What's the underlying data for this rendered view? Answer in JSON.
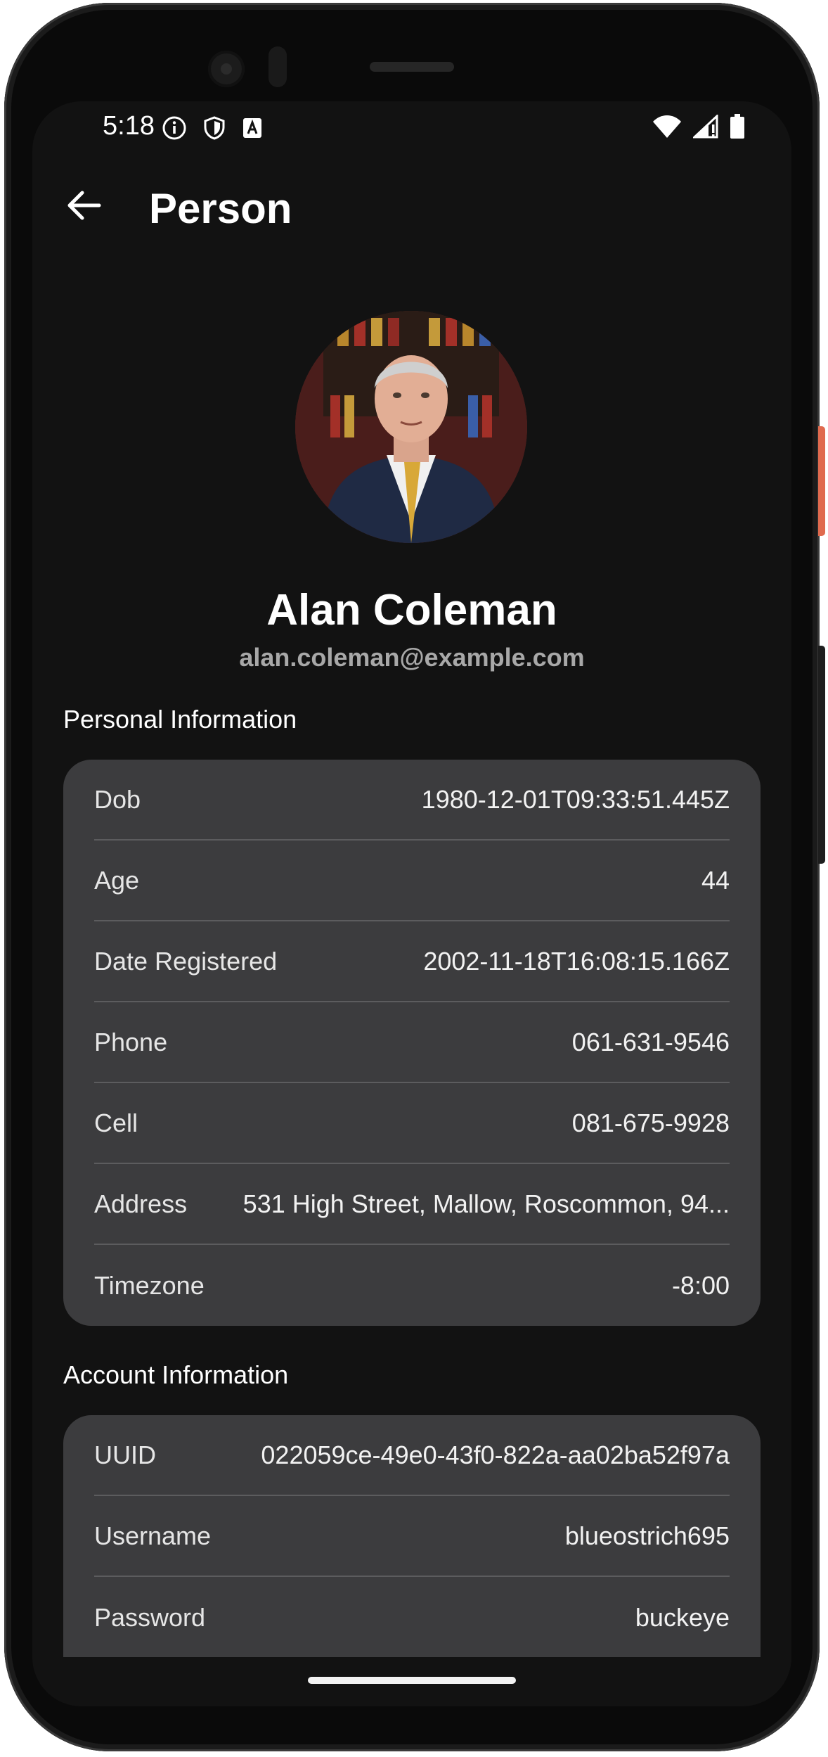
{
  "status_bar": {
    "time": "5:18",
    "icons_left": [
      "info-icon",
      "shield-icon",
      "a-icon"
    ],
    "icons_right": [
      "wifi-icon",
      "signal-icon",
      "battery-icon"
    ]
  },
  "app_bar": {
    "back_icon": "arrow-left-icon",
    "title": "Person"
  },
  "profile": {
    "name": "Alan Coleman",
    "email": "alan.coleman@example.com"
  },
  "personal": {
    "title": "Personal Information",
    "rows": [
      {
        "label": "Dob",
        "value": "1980-12-01T09:33:51.445Z"
      },
      {
        "label": "Age",
        "value": "44"
      },
      {
        "label": "Date Registered",
        "value": "2002-11-18T16:08:15.166Z"
      },
      {
        "label": "Phone",
        "value": "061-631-9546"
      },
      {
        "label": "Cell",
        "value": "081-675-9928"
      },
      {
        "label": "Address",
        "value": "531 High Street, Mallow, Roscommon, 94..."
      },
      {
        "label": "Timezone",
        "value": "-8:00"
      }
    ]
  },
  "account": {
    "title": "Account Information",
    "rows": [
      {
        "label": "UUID",
        "value": "022059ce-49e0-43f0-822a-aa02ba52f97a"
      },
      {
        "label": "Username",
        "value": "blueostrich695"
      },
      {
        "label": "Password",
        "value": "buckeye"
      }
    ]
  },
  "colors": {
    "background": "#121212",
    "card": "#3c3c3e",
    "divider": "#5c5c5e",
    "text_primary": "#ffffff",
    "text_secondary": "#a8a8a8"
  }
}
